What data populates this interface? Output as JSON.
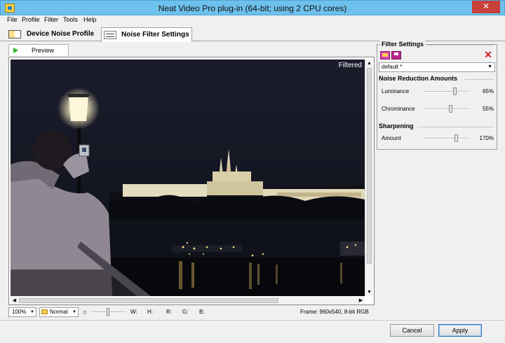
{
  "window": {
    "title": "Neat Video Pro plug-in (64-bit; using 2 CPU cores)",
    "close_glyph": "✕"
  },
  "menu": [
    "File",
    "Profile",
    "Filter",
    "Tools",
    "Help"
  ],
  "tabs": {
    "device_noise_profile": "Device Noise Profile",
    "noise_filter_settings": "Noise Filter Settings"
  },
  "preview": {
    "tab_label": "Preview",
    "overlay_label": "Filtered"
  },
  "status": {
    "zoom": "100%",
    "mode": "Normal",
    "w_label": "W:",
    "h_label": "H:",
    "r_label": "R:",
    "g_label": "G:",
    "b_label": "B:",
    "frame_info": "Frame: 960x540, 8-bit RGB"
  },
  "filter_settings": {
    "title": "Filter Settings",
    "preset": "default *",
    "delete_glyph": "✕",
    "noise_reduction": {
      "title": "Noise Reduction Amounts",
      "luminance": {
        "label": "Luminance",
        "value": "65%",
        "level": 65
      },
      "chrominance": {
        "label": "Chrominance",
        "value": "55%",
        "level": 55
      }
    },
    "sharpening": {
      "title": "Sharpening",
      "amount": {
        "label": "Amount",
        "value": "170%",
        "level": 170
      }
    }
  },
  "buttons": {
    "cancel": "Cancel",
    "apply": "Apply"
  }
}
